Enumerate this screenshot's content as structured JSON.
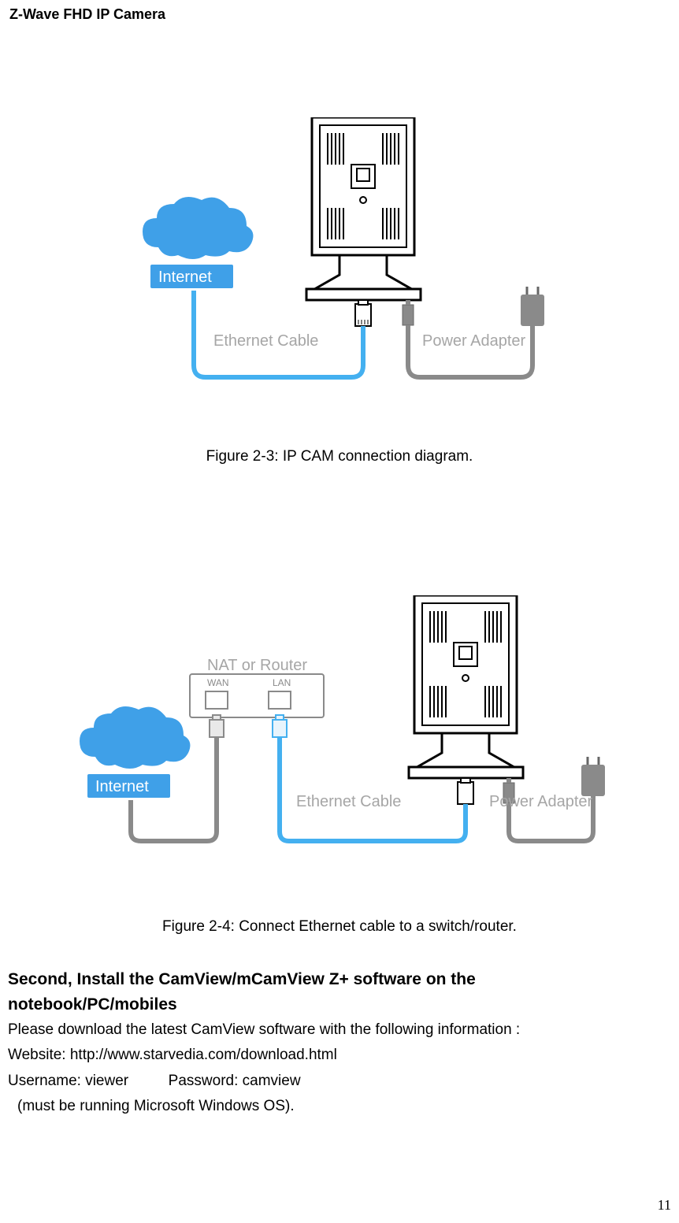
{
  "header": "Z-Wave FHD IP Camera",
  "figures": {
    "fig1": {
      "caption": "Figure 2-3: IP CAM connection diagram.",
      "labels": {
        "internet": "Internet",
        "ethernet": "Ethernet Cable",
        "power": "Power Adapter"
      }
    },
    "fig2": {
      "caption": "Figure 2-4: Connect Ethernet cable to a switch/router.",
      "labels": {
        "internet": "Internet",
        "nat": "NAT or Router",
        "wan": "WAN",
        "lan": "LAN",
        "ethernet": "Ethernet Cable",
        "power": "Power Adapter"
      }
    }
  },
  "section": {
    "title_line1": "Second, Install the CamView/mCamView Z+ software on the",
    "title_line2": "notebook/PC/mobiles",
    "line1": "Please download the latest CamView software with the following information :",
    "line2": "Website: http://www.starvedia.com/download.html",
    "line3a": "Username: viewer",
    "line3b": "Password: camview",
    "line4": "(must be running Microsoft Windows OS)."
  },
  "page_number": "11"
}
